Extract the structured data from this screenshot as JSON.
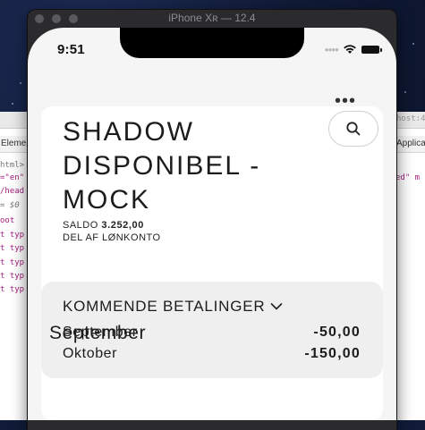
{
  "simulator": {
    "window_title": "iPhone Xʀ — 12.4"
  },
  "background_window": {
    "tab_left": "Eleme",
    "tab_right": "Applica",
    "address_fragment": "host:4",
    "code_lines_left": [
      "html>",
      "=\"en\"",
      "/head",
      "= $0",
      "oot",
      "t typ",
      "t typ",
      "t typ",
      "t typ",
      "t typ"
    ],
    "code_line_right": "ed\" m"
  },
  "status_bar": {
    "time": "9:51"
  },
  "account": {
    "title": "SHADOW DISPONIBEL - MOCK",
    "balance_label": "SALDO",
    "balance_value": "3.252,00",
    "subtitle": "DEL AF LØNKONTO"
  },
  "upcoming_payments": {
    "title": "KOMMENDE BETALINGER",
    "rows": [
      {
        "month": "September",
        "amount": "-50,00"
      },
      {
        "month": "Oktober",
        "amount": "-150,00"
      }
    ]
  },
  "section": {
    "heading": "September"
  },
  "icons": {
    "more": "more-dots-icon",
    "search": "search-icon",
    "chevron": "chevron-down-icon",
    "wifi": "wifi-icon",
    "battery": "battery-icon"
  },
  "colors": {
    "screen_bg": "#f5f5f5",
    "card_bg": "#ffffff",
    "upcoming_bg": "#efefef",
    "text": "#1c1c1c"
  }
}
